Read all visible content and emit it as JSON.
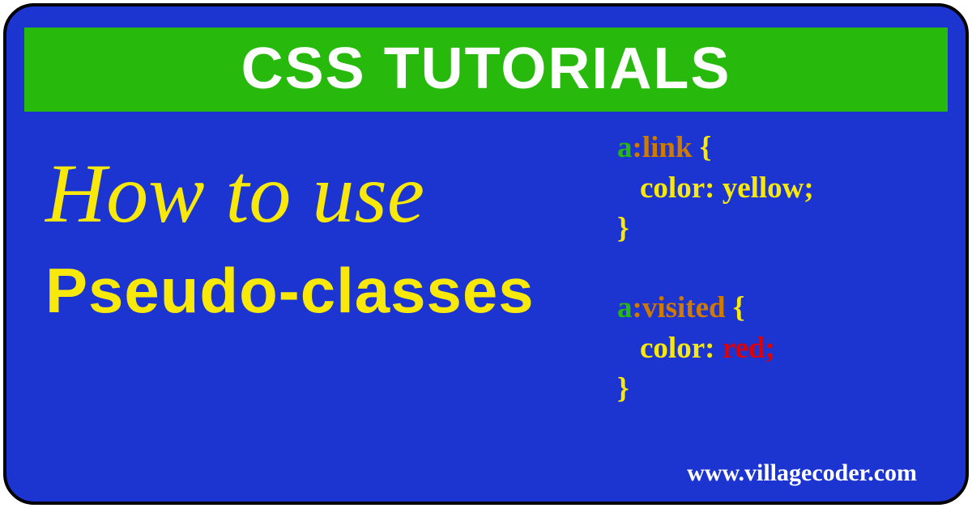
{
  "header": {
    "title": "CSS TUTORIALS"
  },
  "hero": {
    "line1": "How to use",
    "line2": "Pseudo-classes"
  },
  "code": {
    "block1": {
      "sel_a": "a",
      "sel_pseudo": ":link",
      "brace_open": " {",
      "prop": "color:",
      "val": " yellow;",
      "brace_close": "}"
    },
    "block2": {
      "sel_a": "a",
      "sel_pseudo": ":visited",
      "brace_open": " {",
      "prop": "color:",
      "val": " red;",
      "brace_close": "}"
    }
  },
  "footer": {
    "url": "www.villagecoder.com"
  }
}
